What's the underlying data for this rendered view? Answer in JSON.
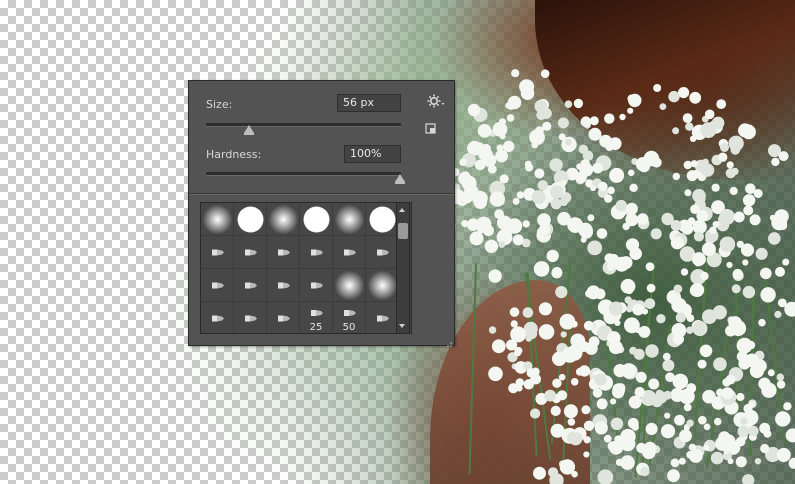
{
  "brush_panel": {
    "size_label": "Size:",
    "size_value": "56 px",
    "size_slider_level": 0.22,
    "hardness_label": "Hardness:",
    "hardness_value": "100%",
    "hardness_slider_level": 1.0,
    "settings_icon": "gear-icon",
    "new_preset_icon": "new-preset-icon",
    "presets": [
      {
        "kind": "soft",
        "num": ""
      },
      {
        "kind": "hard",
        "num": ""
      },
      {
        "kind": "soft",
        "num": ""
      },
      {
        "kind": "hard",
        "num": ""
      },
      {
        "kind": "soft",
        "num": ""
      },
      {
        "kind": "hard",
        "num": ""
      },
      {
        "kind": "tip",
        "num": ""
      },
      {
        "kind": "tip",
        "num": ""
      },
      {
        "kind": "tip",
        "num": ""
      },
      {
        "kind": "tip",
        "num": ""
      },
      {
        "kind": "tip",
        "num": ""
      },
      {
        "kind": "tip",
        "num": ""
      },
      {
        "kind": "tip",
        "num": ""
      },
      {
        "kind": "tip",
        "num": ""
      },
      {
        "kind": "tip",
        "num": ""
      },
      {
        "kind": "tip",
        "num": ""
      },
      {
        "kind": "soft",
        "num": ""
      },
      {
        "kind": "soft",
        "num": ""
      },
      {
        "kind": "tip",
        "num": ""
      },
      {
        "kind": "tip",
        "num": ""
      },
      {
        "kind": "tip",
        "num": ""
      },
      {
        "kind": "tip",
        "num": "25"
      },
      {
        "kind": "tip",
        "num": "50"
      },
      {
        "kind": "tip",
        "num": ""
      }
    ]
  },
  "colors": {
    "panel_bg": "#535353",
    "field_bg": "#434343",
    "grid_bg": "#474747"
  }
}
